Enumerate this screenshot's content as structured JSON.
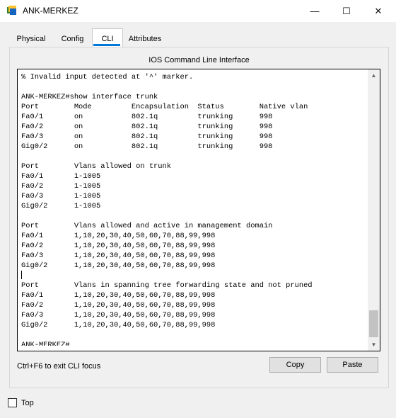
{
  "window": {
    "title": "ANK-MERKEZ",
    "controls": {
      "minimize": "—",
      "maximize": "☐",
      "close": "✕"
    }
  },
  "tabs": [
    {
      "label": "Physical"
    },
    {
      "label": "Config"
    },
    {
      "label": "CLI",
      "active": true
    },
    {
      "label": "Attributes"
    }
  ],
  "panel": {
    "title": "IOS Command Line Interface",
    "console_text": "% Invalid input detected at '^' marker.\n\nANK-MERKEZ#show interface trunk\nPort        Mode         Encapsulation  Status        Native vlan\nFa0/1       on           802.1q         trunking      998\nFa0/2       on           802.1q         trunking      998\nFa0/3       on           802.1q         trunking      998\nGig0/2      on           802.1q         trunking      998\n\nPort        Vlans allowed on trunk\nFa0/1       1-1005\nFa0/2       1-1005\nFa0/3       1-1005\nGig0/2      1-1005\n\nPort        Vlans allowed and active in management domain\nFa0/1       1,10,20,30,40,50,60,70,88,99,998\nFa0/2       1,10,20,30,40,50,60,70,88,99,998\nFa0/3       1,10,20,30,40,50,60,70,88,99,998\nGig0/2      1,10,20,30,40,50,60,70,88,99,998\n\nPort        Vlans in spanning tree forwarding state and not pruned\nFa0/1       1,10,20,30,40,50,60,70,88,99,998\nFa0/2       1,10,20,30,40,50,60,70,88,99,998\nFa0/3       1,10,20,30,40,50,60,70,88,99,998\nGig0/2      1,10,20,30,40,50,60,70,88,99,998\n\nANK-MERKEZ#",
    "scroll": {
      "up_icon": "▲",
      "down_icon": "▼"
    },
    "hint": "Ctrl+F6 to exit CLI focus",
    "copy_label": "Copy",
    "paste_label": "Paste"
  },
  "footer": {
    "top_label": "Top",
    "top_checked": false
  },
  "colors": {
    "accent": "#0078d7",
    "window_bg": "#f0f0f0",
    "console_bg": "#ffffff"
  }
}
